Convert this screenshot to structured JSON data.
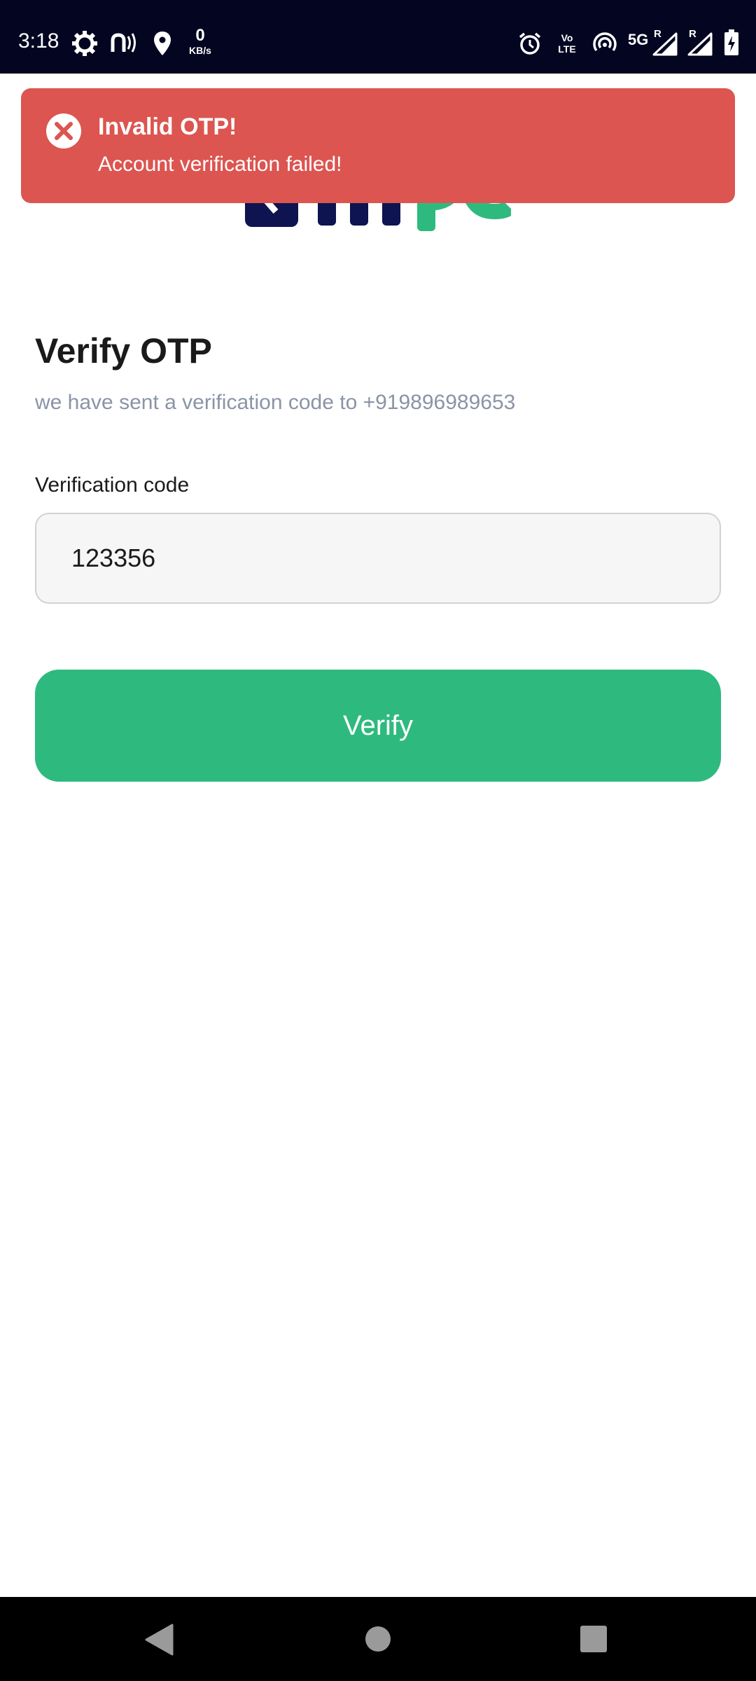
{
  "status_bar": {
    "time": "3:18",
    "network_speed_value": "0",
    "network_speed_unit": "KB/s",
    "volte_top": "Vo",
    "volte_bottom": "LTE",
    "network_type": "5G",
    "roaming_1": "R",
    "roaming_2": "R",
    "icons": [
      "settings-gear-icon",
      "nfc-icon",
      "location-icon",
      "alarm-icon",
      "volte-icon",
      "hotspot-icon",
      "signal-icon",
      "signal-icon",
      "battery-charging-icon"
    ]
  },
  "toast": {
    "title": "Invalid OTP!",
    "message": "Account verification failed!",
    "icon": "error-circle-x-icon",
    "background_color": "#dc5550"
  },
  "logo": {
    "colors": {
      "navy": "#0e1450",
      "green": "#2eba7e"
    }
  },
  "form": {
    "title": "Verify OTP",
    "subtitle": "we have sent a verification code to +919896989653",
    "code_label": "Verification code",
    "code_value": "123356",
    "verify_button_label": "Verify",
    "accent_color": "#2eba7e"
  },
  "nav_bar": {
    "buttons": [
      "back-icon",
      "home-icon",
      "recents-icon"
    ]
  }
}
